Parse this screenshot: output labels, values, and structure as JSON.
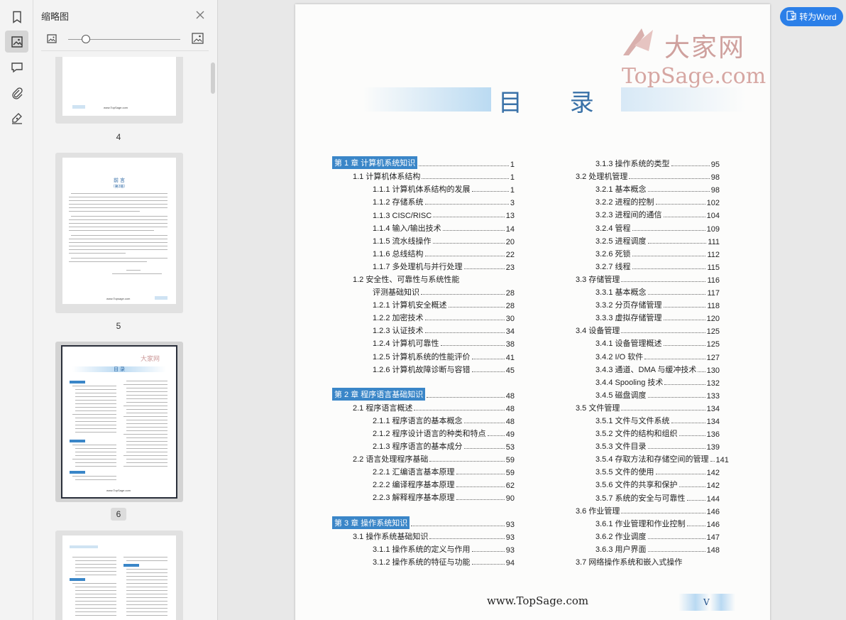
{
  "sidebar_rail": {
    "items": [
      "bookmark-icon",
      "thumbnail-icon",
      "comment-icon",
      "attachment-icon",
      "signature-icon"
    ],
    "active": "thumbnail-icon"
  },
  "thumbnail_panel": {
    "title": "缩略图",
    "zoom_fraction": 0.16,
    "thumbnails": [
      {
        "page_label": "4"
      },
      {
        "page_label": "5"
      },
      {
        "page_label": "6",
        "selected": true
      },
      {
        "page_label": ""
      }
    ],
    "thumb5": {
      "title": "前  言",
      "subtitle": "（第2版）",
      "footer": "www.Topsage.com"
    },
    "thumb6": {
      "title": "目  录",
      "footer": "www.TopSage.com"
    },
    "thumb4": {
      "footer": "www.TopSage.com"
    }
  },
  "toolbar": {
    "to_word_label": "转为Word"
  },
  "document": {
    "watermark_logo": "大家网",
    "watermark_url": "TopSage.com",
    "toc_title": "目  录",
    "left_column": [
      {
        "level": "ch",
        "label": "第 1 章   计算机系统知识",
        "page": "1"
      },
      {
        "level": "sec",
        "label": "1.1   计算机体系结构",
        "page": "1"
      },
      {
        "level": "sub",
        "label": "1.1.1   计算机体系结构的发展",
        "page": "1"
      },
      {
        "level": "sub",
        "label": "1.1.2   存储系统",
        "page": "3"
      },
      {
        "level": "sub",
        "label": "1.1.3   CISC/RISC",
        "page": "13"
      },
      {
        "level": "sub",
        "label": "1.1.4   输入/输出技术",
        "page": "14"
      },
      {
        "level": "sub",
        "label": "1.1.5   流水线操作",
        "page": "20"
      },
      {
        "level": "sub",
        "label": "1.1.6   总线结构",
        "page": "22"
      },
      {
        "level": "sub",
        "label": "1.1.7   多处理机与并行处理",
        "page": "23"
      },
      {
        "level": "sec",
        "label": "1.2   安全性、可靠性与系统性能",
        "page": ""
      },
      {
        "level": "cont",
        "label": "评测基础知识",
        "page": "28"
      },
      {
        "level": "sub",
        "label": "1.2.1   计算机安全概述",
        "page": "28"
      },
      {
        "level": "sub",
        "label": "1.2.2   加密技术",
        "page": "30"
      },
      {
        "level": "sub",
        "label": "1.2.3   认证技术",
        "page": "34"
      },
      {
        "level": "sub",
        "label": "1.2.4   计算机可靠性",
        "page": "38"
      },
      {
        "level": "sub",
        "label": "1.2.5   计算机系统的性能评价",
        "page": "41"
      },
      {
        "level": "sub",
        "label": "1.2.6   计算机故障诊断与容错",
        "page": "45"
      },
      {
        "level": "gap",
        "label": "",
        "page": ""
      },
      {
        "level": "ch",
        "label": "第 2 章   程序语言基础知识",
        "page": "48"
      },
      {
        "level": "sec",
        "label": "2.1   程序语言概述",
        "page": "48"
      },
      {
        "level": "sub",
        "label": "2.1.1   程序语言的基本概念",
        "page": "48"
      },
      {
        "level": "sub",
        "label": "2.1.2   程序设计语言的种类和特点",
        "page": "49"
      },
      {
        "level": "sub",
        "label": "2.1.3   程序语言的基本成分",
        "page": "53"
      },
      {
        "level": "sec",
        "label": "2.2   语言处理程序基础",
        "page": "59"
      },
      {
        "level": "sub",
        "label": "2.2.1   汇编语言基本原理",
        "page": "59"
      },
      {
        "level": "sub",
        "label": "2.2.2   编译程序基本原理",
        "page": "62"
      },
      {
        "level": "sub",
        "label": "2.2.3   解释程序基本原理",
        "page": "90"
      },
      {
        "level": "gap",
        "label": "",
        "page": ""
      },
      {
        "level": "ch",
        "label": "第 3 章   操作系统知识",
        "page": "93"
      },
      {
        "level": "sec",
        "label": "3.1   操作系统基础知识",
        "page": "93"
      },
      {
        "level": "sub",
        "label": "3.1.1   操作系统的定义与作用",
        "page": "93"
      },
      {
        "level": "sub",
        "label": "3.1.2   操作系统的特征与功能",
        "page": "94"
      }
    ],
    "right_column": [
      {
        "level": "sub",
        "label": "3.1.3   操作系统的类型",
        "page": "95"
      },
      {
        "level": "sec",
        "label": "3.2   处理机管理",
        "page": "98"
      },
      {
        "level": "sub",
        "label": "3.2.1   基本概念",
        "page": "98"
      },
      {
        "level": "sub",
        "label": "3.2.2   进程的控制",
        "page": "102"
      },
      {
        "level": "sub",
        "label": "3.2.3   进程间的通信",
        "page": "104"
      },
      {
        "level": "sub",
        "label": "3.2.4   管程",
        "page": "109"
      },
      {
        "level": "sub",
        "label": "3.2.5   进程调度",
        "page": "111"
      },
      {
        "level": "sub",
        "label": "3.2.6   死锁",
        "page": "112"
      },
      {
        "level": "sub",
        "label": "3.2.7   线程",
        "page": "115"
      },
      {
        "level": "sec",
        "label": "3.3   存储管理",
        "page": "116"
      },
      {
        "level": "sub",
        "label": "3.3.1   基本概念",
        "page": "117"
      },
      {
        "level": "sub",
        "label": "3.3.2   分页存储管理",
        "page": "118"
      },
      {
        "level": "sub",
        "label": "3.3.3   虚拟存储管理",
        "page": "120"
      },
      {
        "level": "sec",
        "label": "3.4   设备管理",
        "page": "125"
      },
      {
        "level": "sub",
        "label": "3.4.1   设备管理概述",
        "page": "125"
      },
      {
        "level": "sub",
        "label": "3.4.2   I/O 软件",
        "page": "127"
      },
      {
        "level": "sub",
        "label": "3.4.3   通道、DMA 与缓冲技术",
        "page": "130"
      },
      {
        "level": "sub",
        "label": "3.4.4   Spooling 技术",
        "page": "132"
      },
      {
        "level": "sub",
        "label": "3.4.5   磁盘调度",
        "page": "133"
      },
      {
        "level": "sec",
        "label": "3.5   文件管理",
        "page": "134"
      },
      {
        "level": "sub",
        "label": "3.5.1   文件与文件系统",
        "page": "134"
      },
      {
        "level": "sub",
        "label": "3.5.2   文件的结构和组织",
        "page": "136"
      },
      {
        "level": "sub",
        "label": "3.5.3   文件目录",
        "page": "139"
      },
      {
        "level": "sub",
        "label": "3.5.4   存取方法和存储空间的管理",
        "page": "141"
      },
      {
        "level": "sub",
        "label": "3.5.5   文件的使用",
        "page": "142"
      },
      {
        "level": "sub",
        "label": "3.5.6   文件的共享和保护",
        "page": "142"
      },
      {
        "level": "sub",
        "label": "3.5.7   系统的安全与可靠性",
        "page": "144"
      },
      {
        "level": "sec",
        "label": "3.6   作业管理",
        "page": "146"
      },
      {
        "level": "sub",
        "label": "3.6.1   作业管理和作业控制",
        "page": "146"
      },
      {
        "level": "sub",
        "label": "3.6.2   作业调度",
        "page": "147"
      },
      {
        "level": "sub",
        "label": "3.6.3   用户界面",
        "page": "148"
      },
      {
        "level": "sec",
        "label": "3.7   网络操作系统和嵌入式操作",
        "page": ""
      }
    ],
    "footer_url": "www.TopSage.com",
    "footer_page": "V"
  }
}
